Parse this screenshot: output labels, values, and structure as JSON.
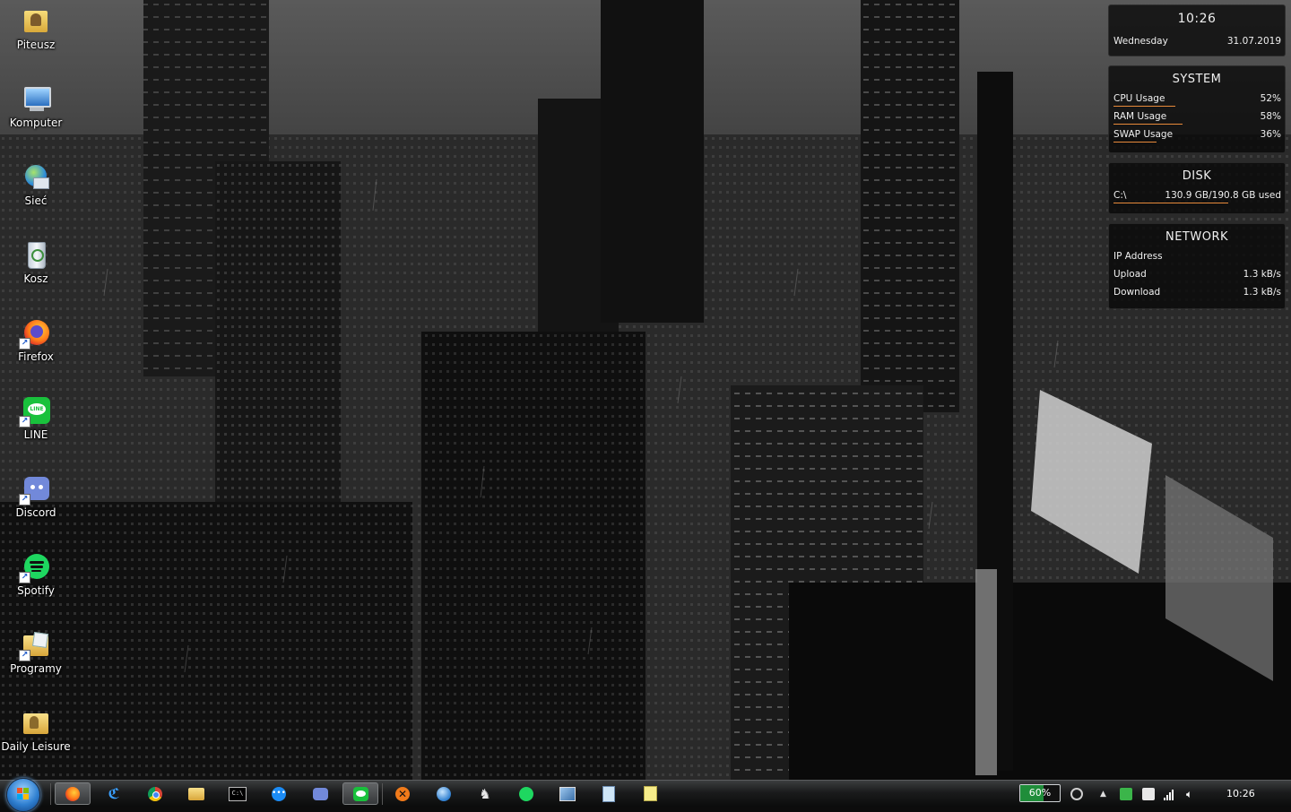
{
  "desktop": {
    "icons": [
      {
        "label": "Piteusz",
        "icon": "user-folder-icon"
      },
      {
        "label": "Komputer",
        "icon": "computer-icon"
      },
      {
        "label": "Sieć",
        "icon": "network-globe-icon"
      },
      {
        "label": "Kosz",
        "icon": "recycle-bin-icon"
      },
      {
        "label": "Firefox",
        "icon": "firefox-icon"
      },
      {
        "label": "LINE",
        "icon": "line-app-icon"
      },
      {
        "label": "Discord",
        "icon": "discord-icon"
      },
      {
        "label": "Spotify",
        "icon": "spotify-icon"
      },
      {
        "label": "Programy",
        "icon": "folder-icon"
      },
      {
        "label": "Daily Leisure",
        "icon": "folder-icon"
      }
    ]
  },
  "widgets": {
    "clock": {
      "time": "10:26",
      "day": "Wednesday",
      "date": "31.07.2019"
    },
    "system": {
      "title": "SYSTEM",
      "rows": [
        {
          "label": "CPU Usage",
          "value": "52%",
          "level": 0.52
        },
        {
          "label": "RAM Usage",
          "value": "58%",
          "level": 0.58
        },
        {
          "label": "SWAP Usage",
          "value": "36%",
          "level": 0.36
        }
      ]
    },
    "disk": {
      "title": "DISK",
      "drive": "C:\\",
      "usage": "130.9 GB/190.8 GB used",
      "level": 0.686
    },
    "network": {
      "title": "NETWORK",
      "ip_label": "IP Address",
      "upload_label": "Upload",
      "upload_value": "1.3 kB/s",
      "download_label": "Download",
      "download_value": "1.3 kB/s"
    }
  },
  "taskbar": {
    "start_icon": "windows-start-orb-icon",
    "apps": [
      {
        "icon": "firefox-icon",
        "active": true
      },
      {
        "icon": "bird-app-icon",
        "active": false
      },
      {
        "icon": "chrome-icon",
        "active": false
      },
      {
        "icon": "file-explorer-icon",
        "active": false
      },
      {
        "icon": "command-prompt-icon",
        "active": false
      },
      {
        "icon": "messenger-icon",
        "active": false
      },
      {
        "icon": "discord-icon",
        "active": false
      },
      {
        "icon": "line-app-icon",
        "active": true
      },
      {
        "icon": "x-app-icon",
        "active": false
      },
      {
        "icon": "settings-globe-icon",
        "active": false
      },
      {
        "icon": "fox-app-icon",
        "active": false
      },
      {
        "icon": "spotify-icon",
        "active": false
      },
      {
        "icon": "network-tool-icon",
        "active": false
      },
      {
        "icon": "notepad-icon",
        "active": false
      },
      {
        "icon": "sticky-notes-icon",
        "active": false
      }
    ],
    "tray": {
      "battery_label": "60%",
      "battery_level": 0.6,
      "clock": "10:26"
    }
  },
  "colors": {
    "bar_accent": "#e88a3a",
    "battery_green": "#1f8d3a"
  }
}
